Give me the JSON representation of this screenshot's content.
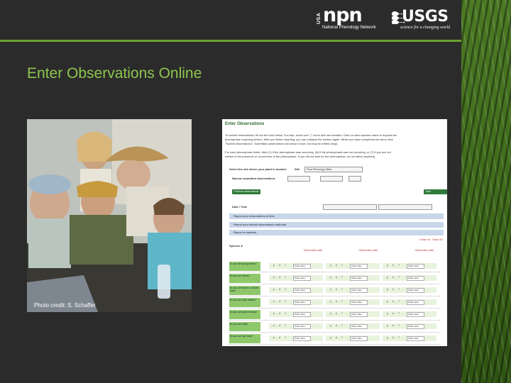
{
  "header": {
    "npn_logo": {
      "usa": "USA",
      "letters": "npn",
      "tagline": "National Phenology Network"
    },
    "usgs_logo": {
      "word": "USGS",
      "tagline": "science for a changing world"
    },
    "accent_color": "#6aa232"
  },
  "slide": {
    "title": "Enter Observations Online",
    "title_color": "#8ec64e"
  },
  "photo": {
    "credit": "Photo credit: S. Schaffer"
  },
  "form_screenshot": {
    "title": "Enter Observations",
    "intro_lines": [
      "To submit observations, fill out the form below. For help, scroll over ⓘ icons and row headers. Click on each species name to expand the",
      "phenophase reporting section. After you finish reporting, you can collapse the section again. When you have completed the form, click",
      "\"Submit observations\". Submitted observations will show in blue, but may be edited (help)."
    ],
    "legend_lines": [
      "For each phenophase listed, click (Y) if the phenophase was occurring, (N) if the phenophase was not occurring, or (?) if you are not",
      "certain of the presence or occurrence of the phenophase. If you did not look for the phenophase, do not select anything."
    ],
    "site_label": "Select the site where your plant is located:",
    "site_select_label": "Site",
    "site_value": "Flora Phenology Office",
    "dates_label": "Narrow submitted observations:",
    "previous_button": "Previous observations",
    "next_button": "Next observations",
    "date_label": "Date / Time",
    "expand_bars": [
      "Report your observations of time",
      "Report your animal observations methods",
      "Report on species"
    ],
    "links": [
      "Clear all",
      "Save All"
    ],
    "species_header": "Species A",
    "columns": [
      "Observation date",
      "Observation date",
      "Observation date"
    ],
    "rows": [
      {
        "question": "Do you see young leaves?",
        "value": "What value"
      },
      {
        "question": "Do you see leaves?",
        "value": "What value"
      },
      {
        "question": "Do you see flowers or flower buds?",
        "value": "What value"
      },
      {
        "question": "Do you see open flowers?",
        "value": "What value"
      },
      {
        "question": "Do you see pollen release?",
        "value": "What value"
      },
      {
        "question": "Do you see fruits?",
        "value": "What value"
      },
      {
        "question": "Do you see ripe fruits?",
        "value": "What value"
      }
    ],
    "yn_options": [
      "y",
      "n",
      "?"
    ]
  }
}
